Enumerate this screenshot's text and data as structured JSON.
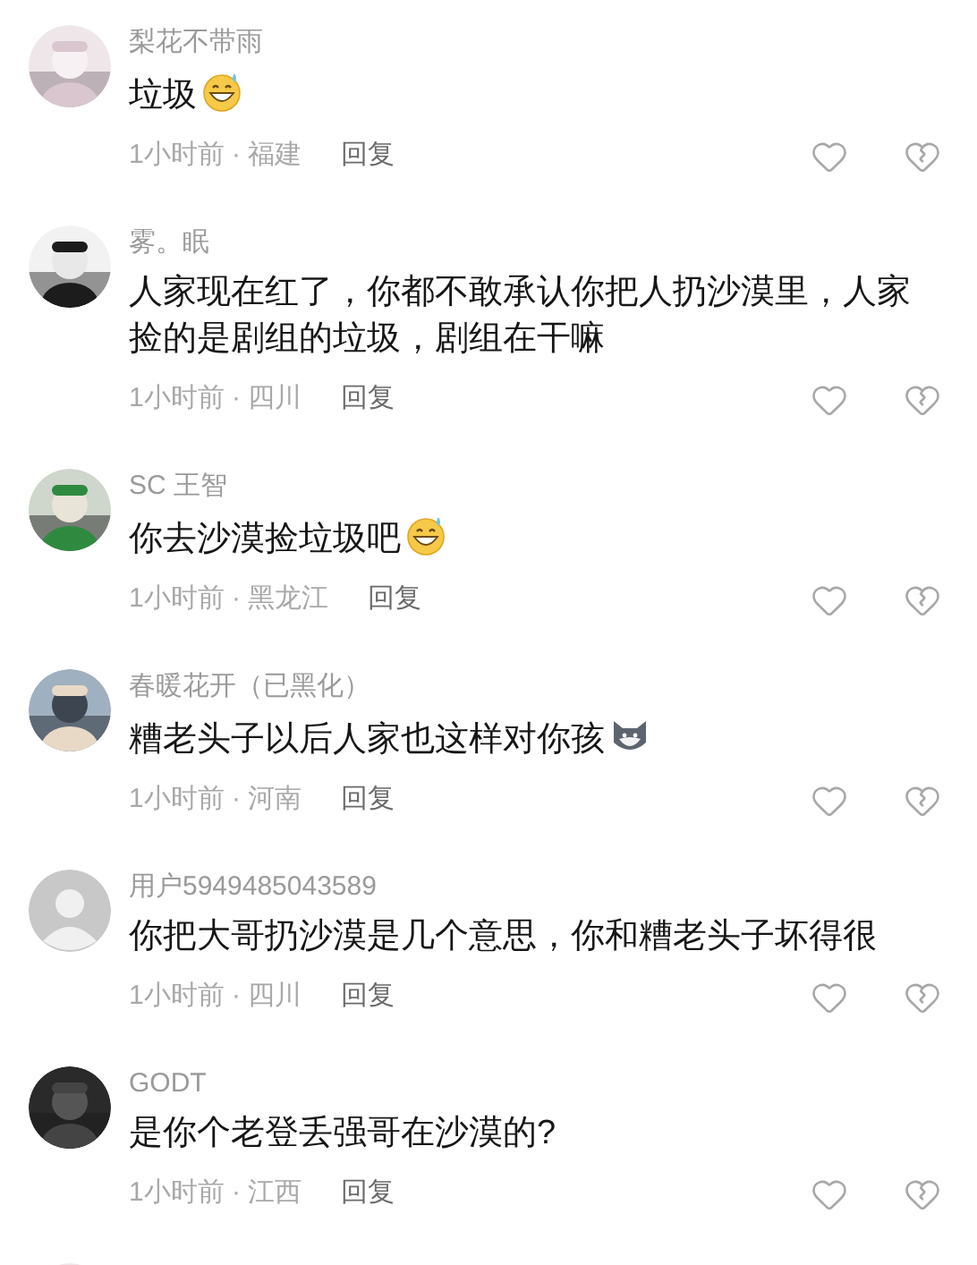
{
  "comments": [
    {
      "avatar": {
        "kind": "picture"
      },
      "name": "梨花不带雨",
      "text": "垃圾",
      "emoji": {
        "kind": "grin-sweat"
      },
      "time": "1小时前 · 福建",
      "reply": "回复"
    },
    {
      "avatar": {
        "kind": "picture"
      },
      "name": "雾。眠",
      "text": "人家现在红了，你都不敢承认你把人扔沙漠里，人家捡的是剧组的垃圾，剧组在干嘛",
      "time": "1小时前 · 四川",
      "reply": "回复"
    },
    {
      "avatar": {
        "kind": "picture"
      },
      "name": "SC 王智",
      "text": "你去沙漠捡垃圾吧",
      "emoji": {
        "kind": "grin-sweat"
      },
      "time": "1小时前 · 黑龙江",
      "reply": "回复"
    },
    {
      "avatar": {
        "kind": "picture"
      },
      "name": "春暖花开（已黑化）",
      "text": "糟老头子以后人家也这样对你孩",
      "emoji": {
        "kind": "wolf"
      },
      "time": "1小时前 · 河南",
      "reply": "回复"
    },
    {
      "avatar": {
        "kind": "default"
      },
      "name": "用户5949485043589",
      "text": "你把大哥扔沙漠是几个意思，你和糟老头子坏得很",
      "time": "1小时前 · 四川",
      "reply": "回复"
    },
    {
      "avatar": {
        "kind": "picture"
      },
      "name": "GODT",
      "text": "是你个老登丢强哥在沙漠的?",
      "time": "1小时前 · 江西",
      "reply": "回复"
    },
    {
      "avatar": {
        "kind": "picture"
      }
    }
  ]
}
